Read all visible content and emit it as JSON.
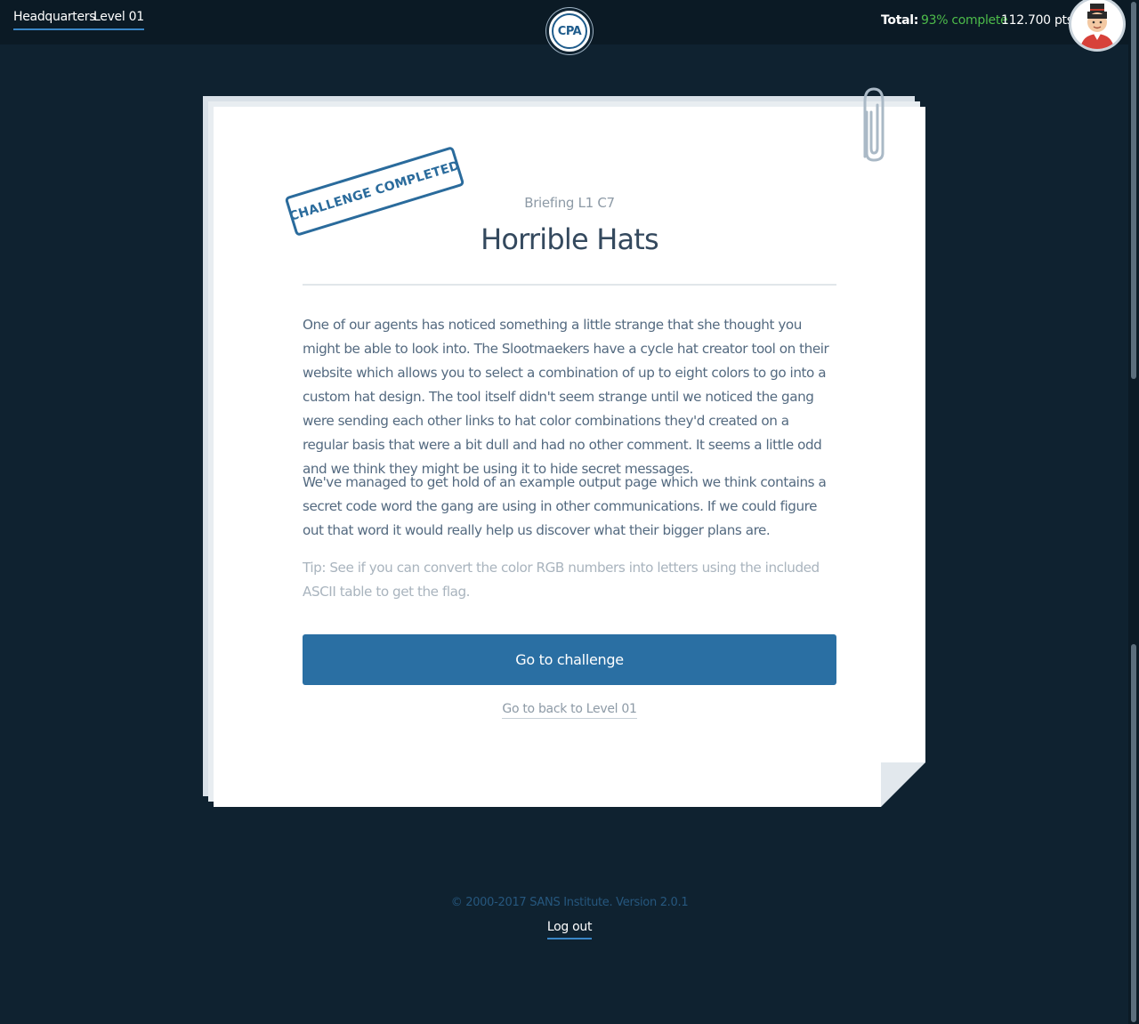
{
  "topbar": {
    "breadcrumbs": [
      "Headquarters",
      "Level 01"
    ],
    "logo_text": "CPA",
    "total_label": "Total:",
    "complete": "93% complete",
    "points": "112.700 pts"
  },
  "briefing": {
    "stamp": "CHALLENGE COMPLETED",
    "subtitle": "Briefing L1 C7",
    "title": "Horrible Hats",
    "paragraphs": [
      "One of our agents has noticed something a little strange that she thought you might be able to look into. The Slootmaekers have a cycle hat creator tool on their website which allows you to select a combination of up to eight colors to go into a custom hat design. The tool itself didn't seem strange until we noticed the gang were sending each other links to hat color combinations they'd created on a regular basis that were a bit dull and had no other comment. It seems a little odd and we think they might be using it to hide secret messages.",
      "We've managed to get hold of an example output page which we think contains a secret code word the gang are using in other communications. If we could figure out that word it would really help us discover what their bigger plans are."
    ],
    "tip": "Tip: See if you can convert the color RGB numbers into letters using the included ASCII table to get the flag.",
    "cta_label": "Go to challenge",
    "back_link": "Go to back to Level 01"
  },
  "footer": {
    "copyright": "© 2000-2017 SANS Institute. Version 2.0.1",
    "logout": "Log out"
  },
  "colors": {
    "background": "#0f2230",
    "accent": "#2a6fa3",
    "complete": "#4dbb4a"
  }
}
